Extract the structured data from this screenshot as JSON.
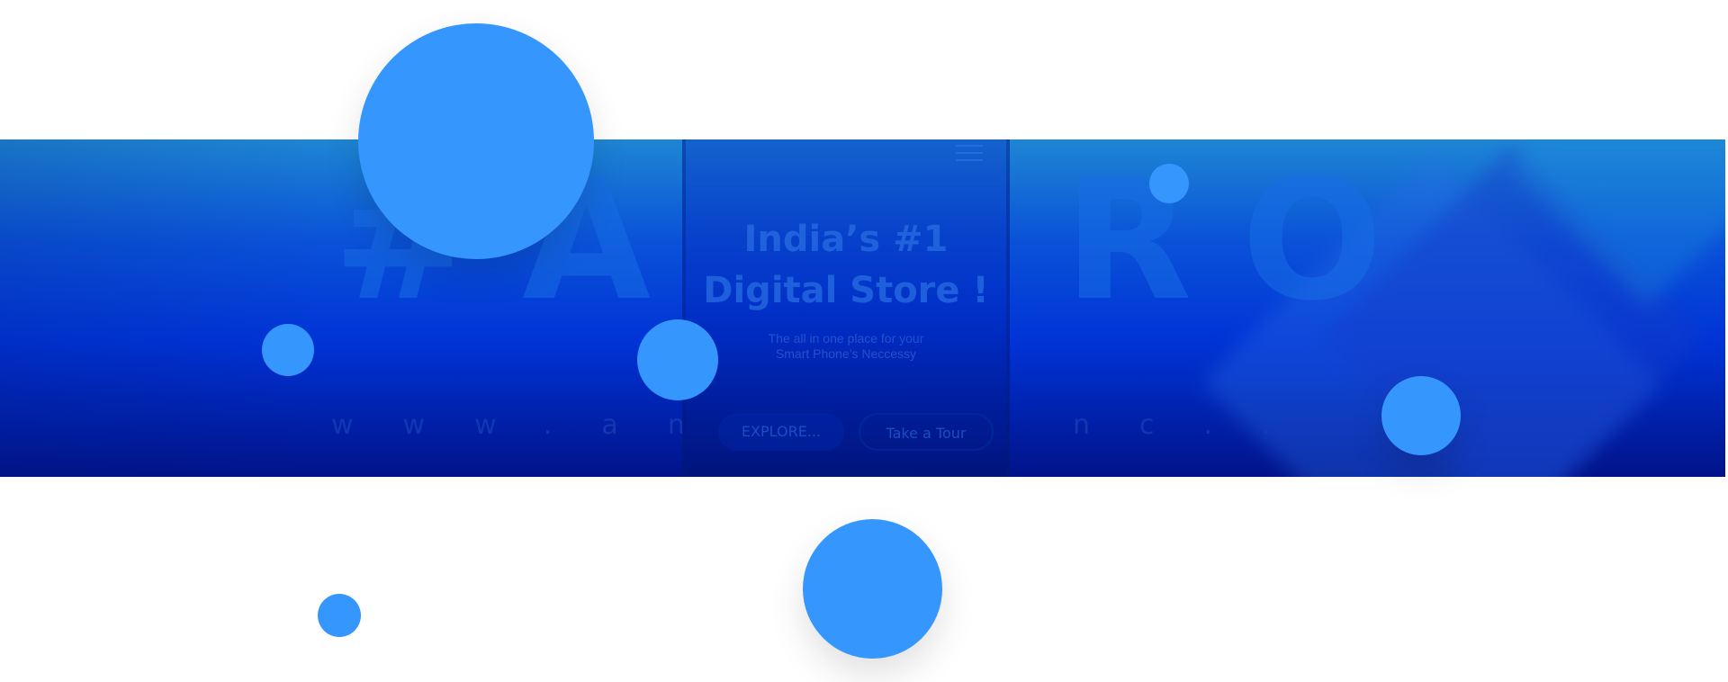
{
  "banner": {
    "left_letters": "#A",
    "right_letters": "RO",
    "left_url": "www.an",
    "right_url": "nc..."
  },
  "phone": {
    "headline_line1": "India’s #1",
    "headline_line2": "Digital Store !",
    "tagline_line1": "The all in one place for your",
    "tagline_line2": "Smart Phone’s Neccessy",
    "explore_label": "EXPLORE...",
    "tour_label": "Take a Tour"
  },
  "icons": {
    "menu": "hamburger-menu-icon"
  },
  "colors": {
    "accent_circle": "#3597fe",
    "banner_top": "#1e86d4",
    "banner_bottom": "#01138a"
  }
}
